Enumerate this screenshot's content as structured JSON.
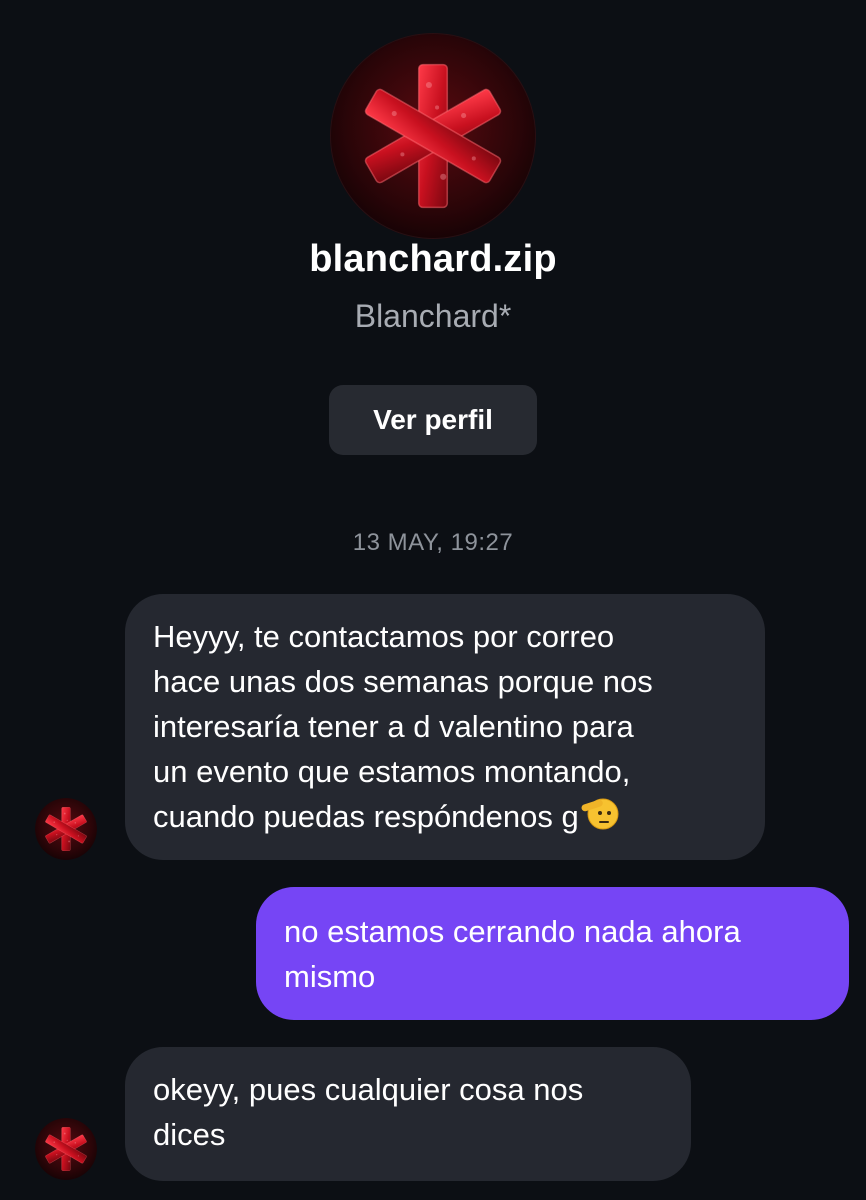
{
  "header": {
    "avatar_icon": "red-asterisk-avatar",
    "username": "blanchard.zip",
    "display_name": "Blanchard*",
    "profile_button_label": "Ver perfil"
  },
  "conversation": {
    "timestamp": "13 MAY, 19:27",
    "messages": [
      {
        "direction": "incoming",
        "text": "Heyyy, te contactamos por correo\nhace unas dos semanas porque nos\ninteresaría tener a d valentino para\nun evento que estamos montando,\ncuando puedas respóndenos g",
        "emoji": "saluting-face"
      },
      {
        "direction": "outgoing",
        "text": "no estamos cerrando nada ahora\nmismo"
      },
      {
        "direction": "incoming",
        "text": "okeyy, pues cualquier cosa nos\ndices"
      }
    ]
  },
  "colors": {
    "background": "#0c0f14",
    "incoming_bubble": "#252830",
    "outgoing_bubble": "#7645f5",
    "secondary_text": "#a8acb3",
    "avatar_red": "#d31a2a"
  }
}
